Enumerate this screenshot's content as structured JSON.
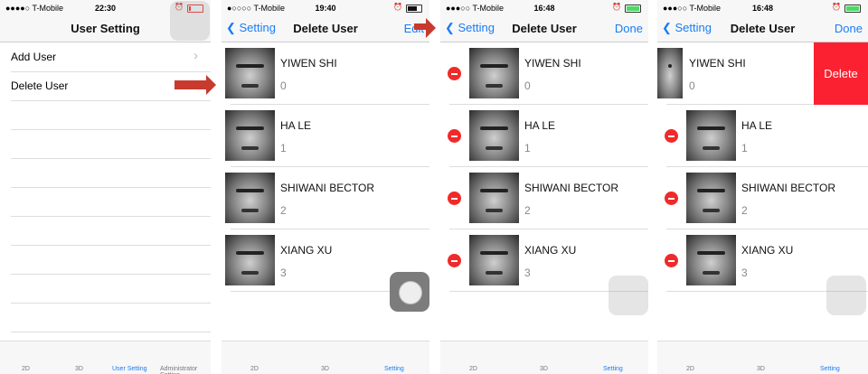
{
  "accent_color": "#1a7cf5",
  "delete_color": "#fb2130",
  "panels": [
    {
      "status": {
        "carrier": "●●●●○ T-Mobile",
        "time": "22:30",
        "battery": "low-red"
      },
      "nav": {
        "title": "User Setting"
      },
      "menu": [
        {
          "label": "Add User",
          "chevron": "›"
        },
        {
          "label": "Delete User"
        }
      ],
      "tabs": [
        {
          "label": "2D"
        },
        {
          "label": "3D"
        },
        {
          "label": "User Setting",
          "active": true
        },
        {
          "label": "Administrator Setting"
        }
      ]
    },
    {
      "status": {
        "carrier": "●○○○○ T-Mobile",
        "time": "19:40",
        "battery": "black"
      },
      "nav": {
        "back": "Setting",
        "title": "Delete User",
        "right": "Edit"
      },
      "tabs": [
        {
          "label": "2D"
        },
        {
          "label": "3D"
        },
        {
          "label": "Setting",
          "active": true
        }
      ]
    },
    {
      "status": {
        "carrier": "●●●○○ T-Mobile",
        "time": "16:48",
        "battery": "green-charging"
      },
      "nav": {
        "back": "Setting",
        "title": "Delete User",
        "right": "Done"
      },
      "tabs": [
        {
          "label": "2D"
        },
        {
          "label": "3D"
        },
        {
          "label": "Setting",
          "active": true
        }
      ]
    },
    {
      "status": {
        "carrier": "●●●○○ T-Mobile",
        "time": "16:48",
        "battery": "green-charging"
      },
      "nav": {
        "back": "Setting",
        "title": "Delete User",
        "right": "Done"
      },
      "delete_label": "Delete",
      "tabs": [
        {
          "label": "2D"
        },
        {
          "label": "3D"
        },
        {
          "label": "Setting",
          "active": true
        }
      ]
    }
  ],
  "users": [
    {
      "name": "YIWEN SHI",
      "id": "0"
    },
    {
      "name": "HA LE",
      "id": "1"
    },
    {
      "name": "SHIWANI BECTOR",
      "id": "2"
    },
    {
      "name": "XIANG XU",
      "id": "3"
    }
  ]
}
